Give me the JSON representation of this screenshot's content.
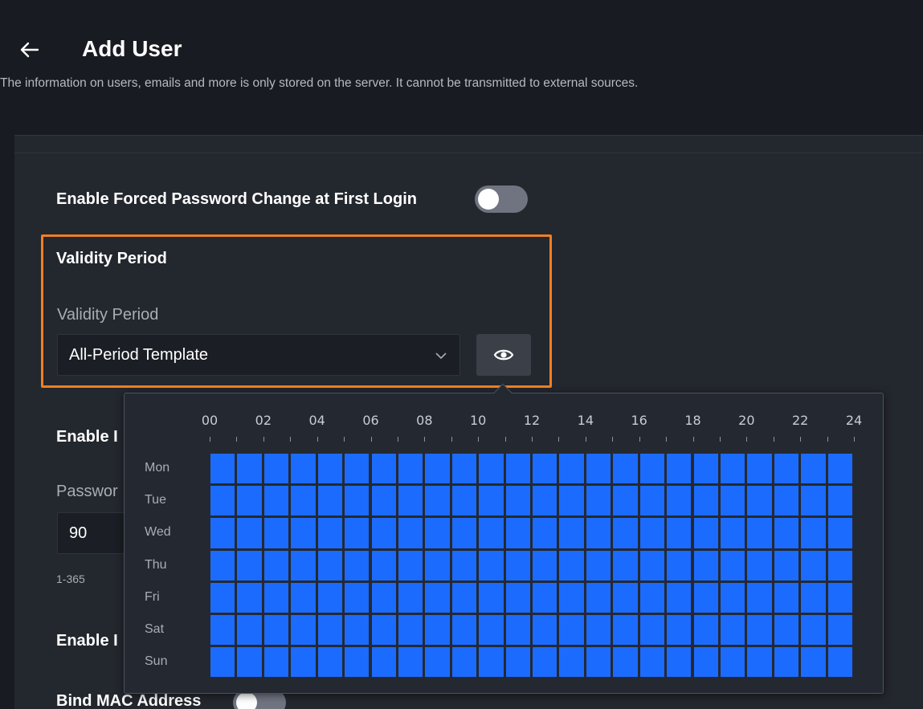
{
  "header": {
    "title": "Add User",
    "description": "The information on users, emails and more is only stored on the server. It cannot be transmitted to external sources."
  },
  "form": {
    "forced_password_change": {
      "label": "Enable Forced Password Change at First Login",
      "enabled": false
    },
    "validity": {
      "heading": "Validity Period",
      "field_label": "Validity Period",
      "selected": "All-Period Template"
    },
    "password_expiry": {
      "label_partial": "Enable I",
      "field_label_partial": "Passwor",
      "value": "90",
      "hint": "1-365"
    },
    "other_toggle": {
      "label_partial": "Enable I"
    },
    "bind_mac": {
      "label": "Bind MAC Address",
      "enabled": false
    }
  },
  "schedule_popover": {
    "hours": [
      "00",
      "02",
      "04",
      "06",
      "08",
      "10",
      "12",
      "14",
      "16",
      "18",
      "20",
      "22",
      "24"
    ],
    "days": [
      "Mon",
      "Tue",
      "Wed",
      "Thu",
      "Fri",
      "Sat",
      "Sun"
    ],
    "slots_per_day": 24,
    "active_color": "#1c6bff"
  },
  "colors": {
    "background": "#181b21",
    "card": "#23272e",
    "highlight_border": "#f07f23",
    "toggle_off": "#6f7480"
  }
}
